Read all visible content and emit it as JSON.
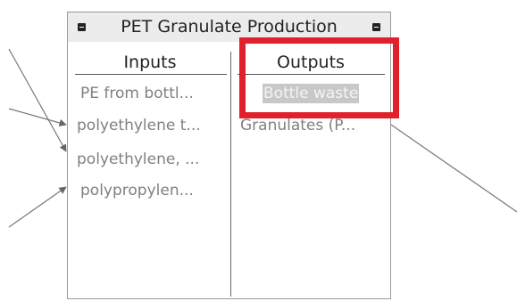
{
  "node": {
    "title": "PET Granulate Production",
    "inputs_header": "Inputs",
    "outputs_header": "Outputs",
    "inputs": [
      "PE from bottl...",
      "polyethylene t...",
      "polyethylene, ...",
      "polypropylen..."
    ],
    "outputs": [
      "Bottle waste",
      "Granulates (P..."
    ]
  },
  "colors": {
    "highlight": "#e0202a",
    "flow_text": "#808080",
    "selected_bg": "#c8c8c8"
  },
  "icons": {
    "left_button": "collapse-icon",
    "right_button": "collapse-icon"
  }
}
